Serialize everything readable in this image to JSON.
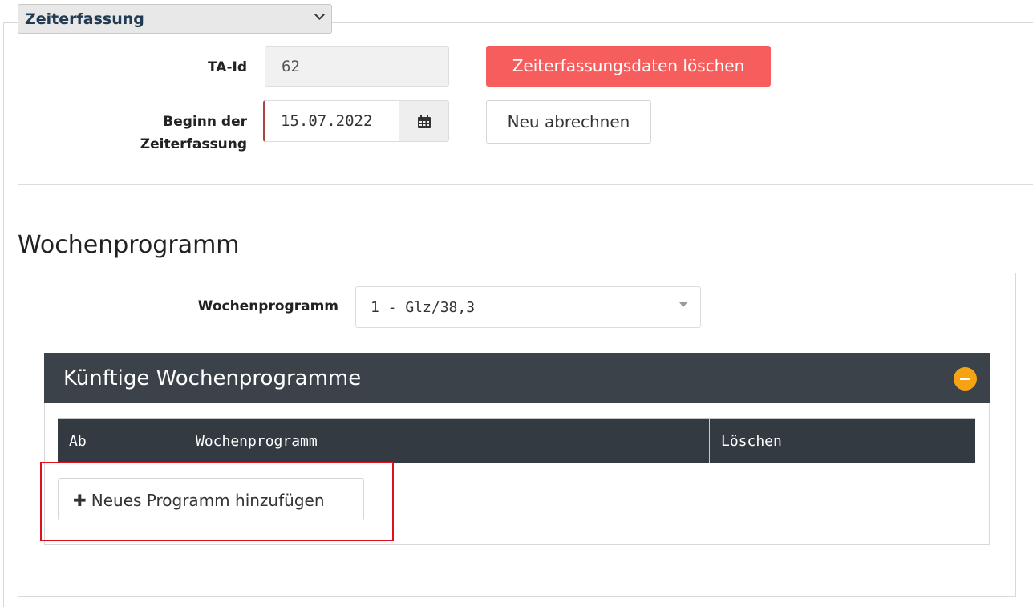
{
  "section_dropdown": {
    "label": "Zeiterfassung"
  },
  "ta": {
    "label": "TA-Id",
    "value": "62"
  },
  "beginn": {
    "label_line1": "Beginn der",
    "label_line2": "Zeiterfassung",
    "value": "15.07.2022"
  },
  "buttons": {
    "delete": "Zeiterfassungsdaten löschen",
    "recalc": "Neu abrechnen",
    "add_program": "Neues Programm hinzufügen"
  },
  "wochenprogramm": {
    "heading": "Wochenprogramm",
    "field_label": "Wochenprogramm",
    "selected": "1 - Glz/38,3"
  },
  "panel": {
    "title": "Künftige Wochenprogramme",
    "columns": [
      "Ab",
      "Wochenprogramm",
      "Löschen"
    ]
  },
  "colors": {
    "danger": "#f65d5d",
    "panel_header": "#3b4249",
    "table_header": "#343a41",
    "collapse": "#f5a312",
    "highlight": "#e0101c"
  },
  "icons": [
    "chevron-down-icon",
    "calendar-icon",
    "dropdown-arrow-icon",
    "minus-icon",
    "plus-icon"
  ]
}
